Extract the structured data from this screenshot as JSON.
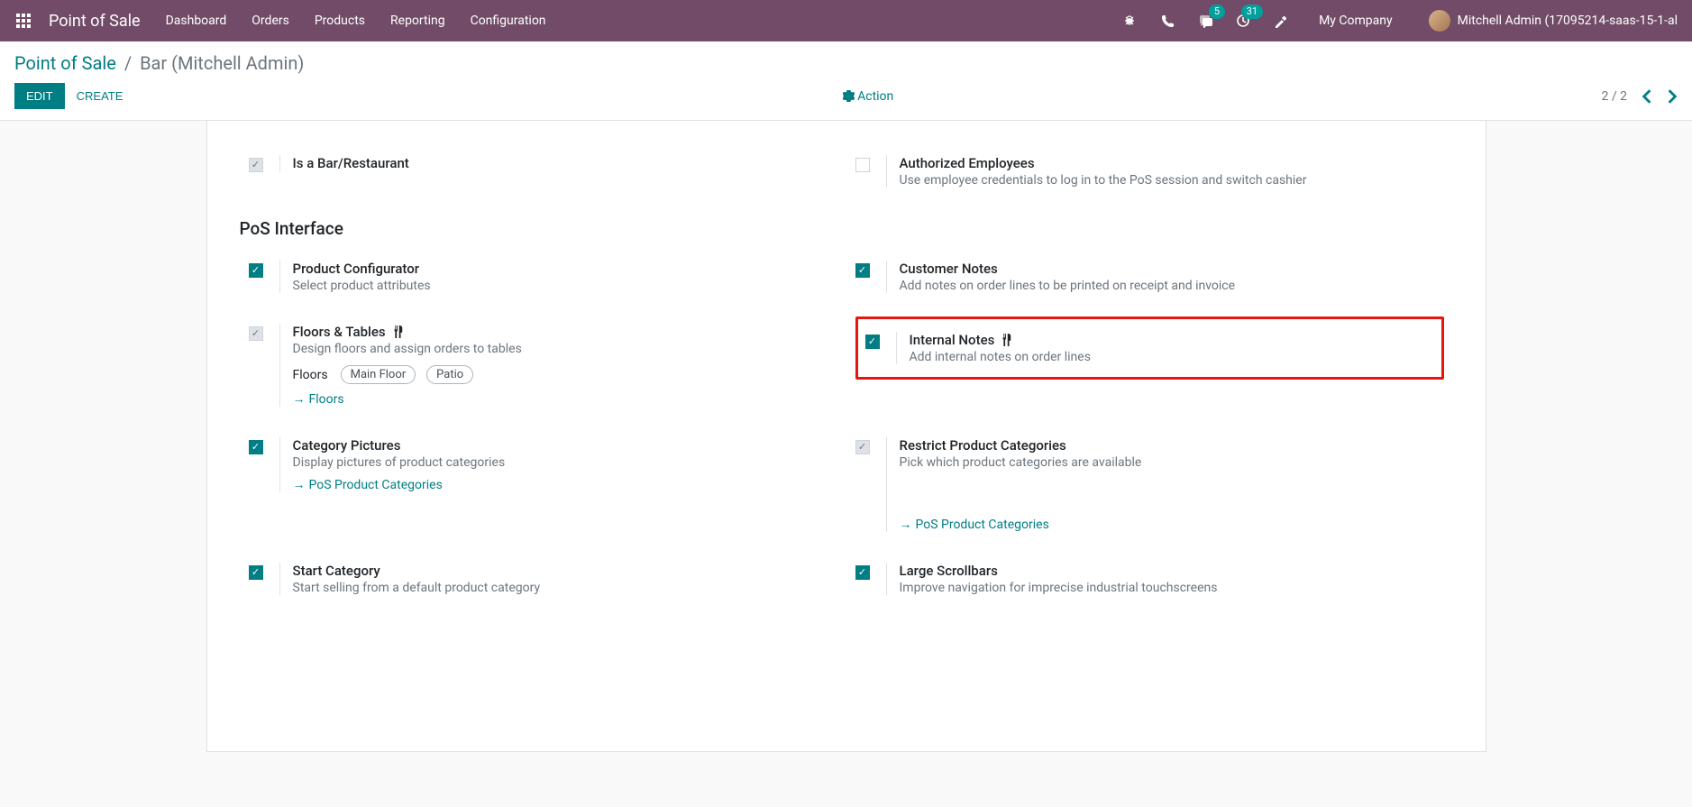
{
  "navbar": {
    "brand": "Point of Sale",
    "menu": [
      "Dashboard",
      "Orders",
      "Products",
      "Reporting",
      "Configuration"
    ],
    "chat_badge": "5",
    "activity_badge": "31",
    "company": "My Company",
    "user": "Mitchell Admin (17095214-saas-15-1-al"
  },
  "breadcrumb": {
    "root": "Point of Sale",
    "current": "Bar (Mitchell Admin)"
  },
  "buttons": {
    "edit": "Edit",
    "create": "Create",
    "action": "Action"
  },
  "pager": {
    "text": "2 / 2"
  },
  "settings": {
    "is_bar": {
      "title": "Is a Bar/Restaurant"
    },
    "authorized_employees": {
      "title": "Authorized Employees",
      "desc": "Use employee credentials to log in to the PoS session and switch cashier"
    },
    "section_interface": "PoS Interface",
    "product_configurator": {
      "title": "Product Configurator",
      "desc": "Select product attributes"
    },
    "customer_notes": {
      "title": "Customer Notes",
      "desc": "Add notes on order lines to be printed on receipt and invoice"
    },
    "floors_tables": {
      "title": "Floors & Tables",
      "desc": "Design floors and assign orders to tables",
      "floors_label": "Floors",
      "tags": [
        "Main Floor",
        "Patio"
      ],
      "link": "Floors"
    },
    "internal_notes": {
      "title": "Internal Notes",
      "desc": "Add internal notes on order lines"
    },
    "category_pictures": {
      "title": "Category Pictures",
      "desc": "Display pictures of product categories",
      "link": "PoS Product Categories"
    },
    "restrict_categories": {
      "title": "Restrict Product Categories",
      "desc": "Pick which product categories are available",
      "link": "PoS Product Categories"
    },
    "start_category": {
      "title": "Start Category",
      "desc": "Start selling from a default product category"
    },
    "large_scrollbars": {
      "title": "Large Scrollbars",
      "desc": "Improve navigation for imprecise industrial touchscreens"
    }
  }
}
